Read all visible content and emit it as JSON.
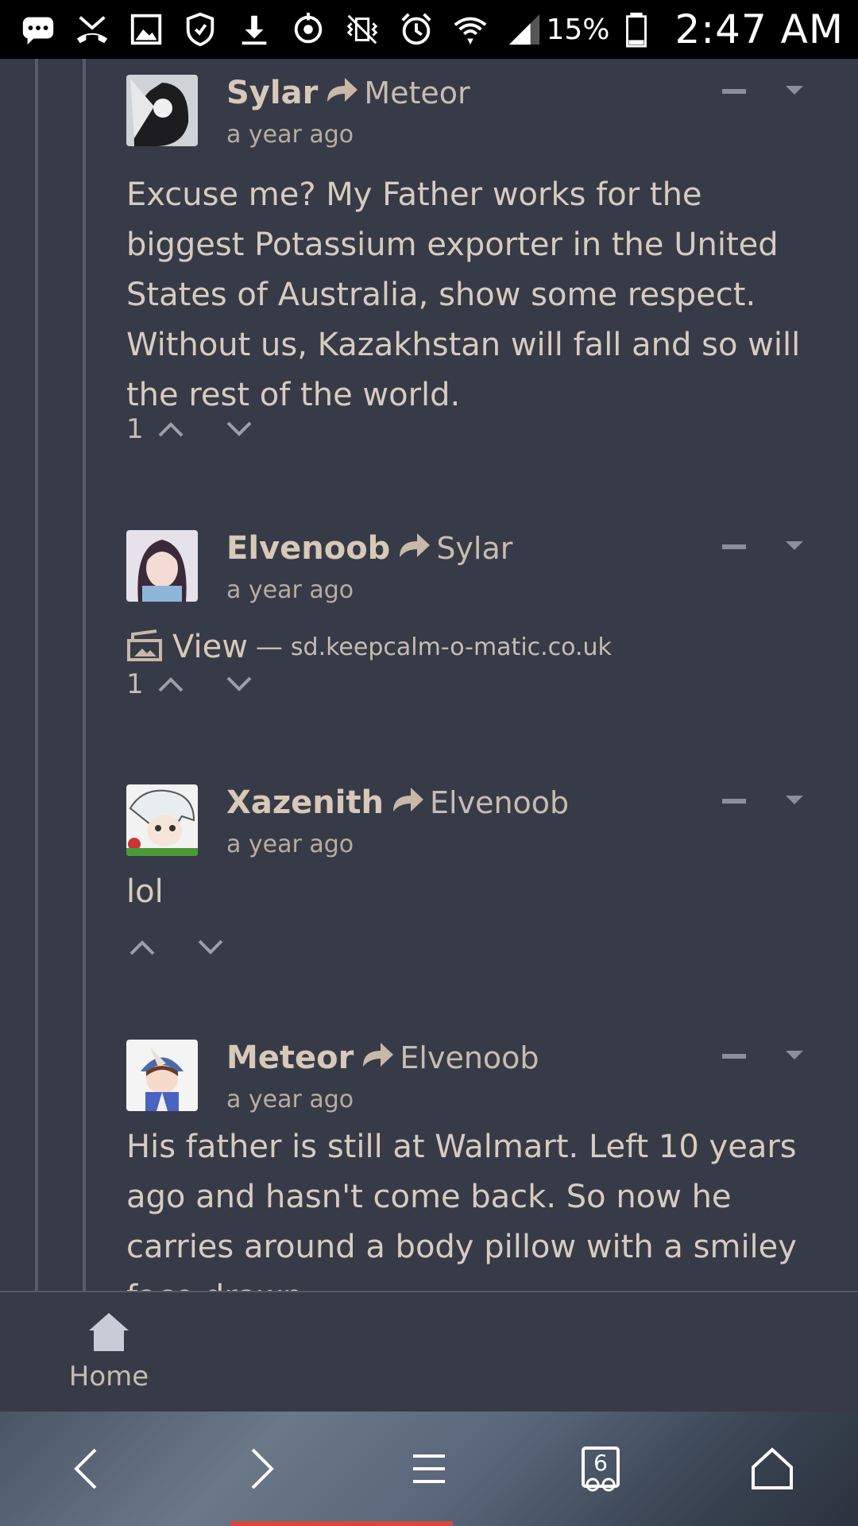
{
  "status_bar": {
    "icons": [
      "chat-bubble-icon",
      "missed-call-icon",
      "image-icon",
      "security-icon",
      "download-icon",
      "sync-icon",
      "vibrate-icon",
      "alarm-icon",
      "wifi-icon",
      "signal-icon",
      "battery-icon"
    ],
    "battery_percent": "15%",
    "time": "2:47 AM"
  },
  "comments": [
    {
      "author": "Sylar",
      "reply_to": "Meteor",
      "time": "a year ago",
      "body": "Excuse me? My Father works for the biggest Potassium exporter in the United States of Australia, show some respect. Without us, Kazakhstan will fall and so will the rest of the world.",
      "votes": "1"
    },
    {
      "author": "Elvenoob",
      "reply_to": "Sylar",
      "time": "a year ago",
      "link_label": "View",
      "link_separator": "—",
      "link_domain": "sd.keepcalm-o-matic.co.uk",
      "votes": "1"
    },
    {
      "author": "Xazenith",
      "reply_to": "Elvenoob",
      "time": "a year ago",
      "body": "lol",
      "votes": ""
    },
    {
      "author": "Meteor",
      "reply_to": "Elvenoob",
      "time": "a year ago",
      "body": "His father is still at Walmart. Left 10 years ago and hasn't come back. So now he carries around a body pillow with a smiley face drawn"
    }
  ],
  "app_nav": {
    "home_label": "Home"
  },
  "browser_toolbar": {
    "tab_count": "6"
  },
  "colors": {
    "background": "#363b47",
    "text": "#d8cbbf",
    "status_bar": "#000000",
    "progress": "#d9473e"
  }
}
